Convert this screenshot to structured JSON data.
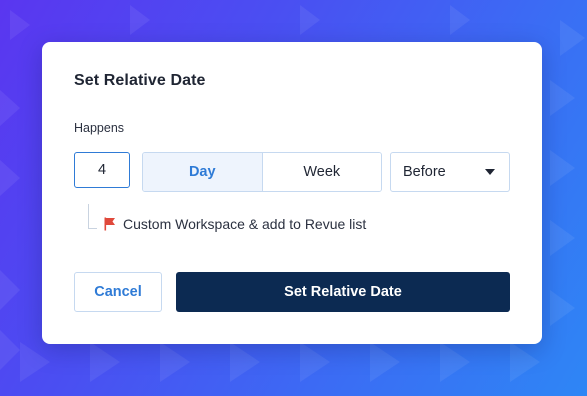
{
  "dialog": {
    "title": "Set Relative Date",
    "field_label": "Happens",
    "quantity_value": "4",
    "units": [
      {
        "label": "Day",
        "selected": true
      },
      {
        "label": "Week",
        "selected": false
      }
    ],
    "direction_select": {
      "value": "Before"
    },
    "task_item": {
      "label": "Custom Workspace & add to Revue list",
      "icon": "flag-icon"
    },
    "cancel_label": "Cancel",
    "confirm_label": "Set Relative Date"
  },
  "colors": {
    "accent": "#2f7bd6",
    "primary_button": "#0c2a52",
    "flag": "#e0493b",
    "selected_unit_bg": "#eef4fd"
  }
}
